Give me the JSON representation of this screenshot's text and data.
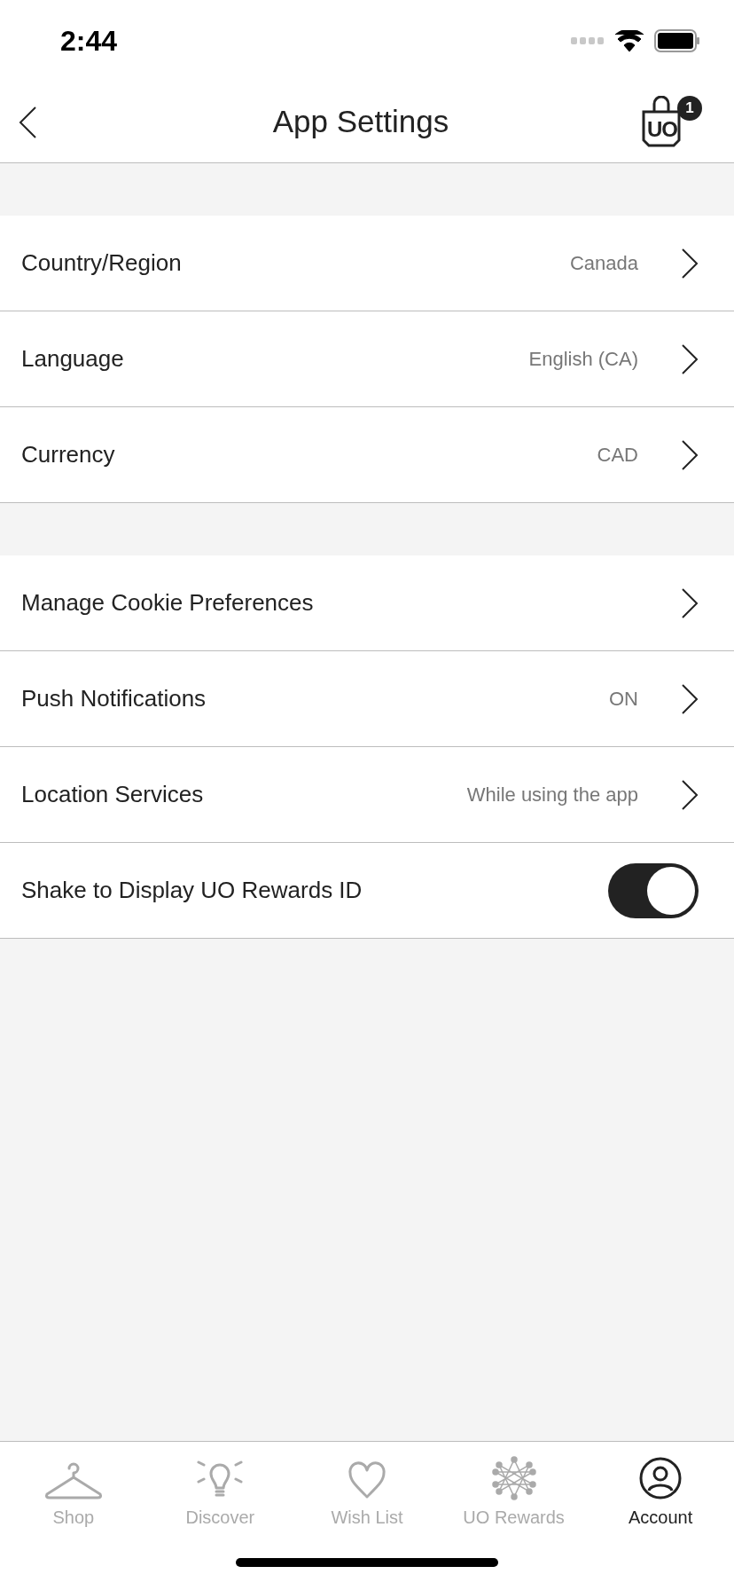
{
  "status_bar": {
    "time": "2:44"
  },
  "nav": {
    "title": "App Settings",
    "bag": {
      "logo": "UO",
      "count": "1"
    }
  },
  "sections": [
    {
      "rows": [
        {
          "kind": "link",
          "label": "Country/Region",
          "value": "Canada"
        },
        {
          "kind": "link",
          "label": "Language",
          "value": "English (CA)"
        },
        {
          "kind": "link",
          "label": "Currency",
          "value": "CAD"
        }
      ]
    },
    {
      "rows": [
        {
          "kind": "link",
          "label": "Manage Cookie Preferences"
        },
        {
          "kind": "link",
          "label": "Push Notifications",
          "value": "ON"
        },
        {
          "kind": "link",
          "label": "Location Services",
          "value": "While using the app"
        },
        {
          "kind": "toggle",
          "label": "Shake to Display UO Rewards ID",
          "on": true
        }
      ]
    }
  ],
  "tab_bar": [
    {
      "kind": "hanger",
      "label": "Shop",
      "selected": false
    },
    {
      "kind": "bulb",
      "label": "Discover",
      "selected": false
    },
    {
      "kind": "heart",
      "label": "Wish List",
      "selected": false
    },
    {
      "kind": "star",
      "label": "UO Rewards",
      "selected": false
    },
    {
      "kind": "person",
      "label": "Account",
      "selected": true
    }
  ]
}
